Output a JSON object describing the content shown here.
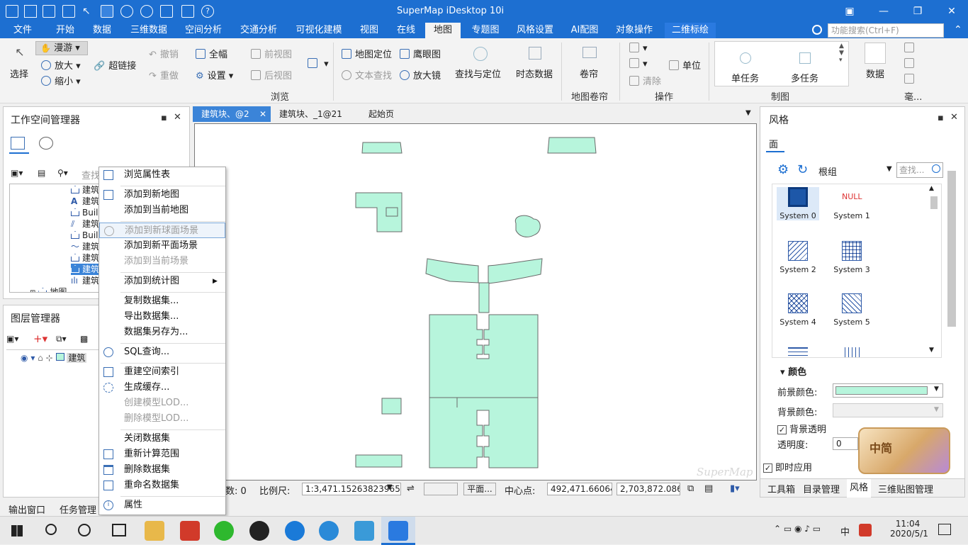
{
  "window": {
    "title": "SuperMap iDesktop 10i",
    "controls": [
      "restore",
      "minimize",
      "maximize",
      "close"
    ]
  },
  "quick_access": [
    "save-icon",
    "new-window-icon",
    "open-icon",
    "pointer-icon",
    "pan-icon",
    "zoom-in-icon",
    "zoom-out-icon",
    "fullextent-icon",
    "folder-icon",
    "help-icon"
  ],
  "menu_tabs": [
    "文件",
    "开始",
    "数据",
    "三维数据",
    "空间分析",
    "交通分析",
    "可视化建模",
    "视图",
    "在线",
    "地图",
    "专题图",
    "风格设置",
    "AI配图",
    "对象操作",
    "二维标绘"
  ],
  "active_tab": "地图",
  "search": {
    "placeholder": "功能搜索(Ctrl+F)"
  },
  "ribbon": {
    "select": "选择",
    "roam": "漫游",
    "zoom_in": "放大",
    "zoom_out": "缩小",
    "hyperlink": "超链接",
    "undo": "撤销",
    "redo": "重做",
    "full_extent": "全幅",
    "settings": "设置",
    "prev_view": "前视图",
    "next_view": "后视图",
    "map_locate": "地图定位",
    "eagle_eye": "鹰眼图",
    "text_search": "文本查找",
    "magnifier": "放大镜",
    "find_locate": "查找与定位",
    "dynamic_data": "时态数据",
    "curtain": "卷帘",
    "unit": "单位",
    "clear": "清除",
    "single_task": "单任务",
    "multi_task": "多任务",
    "data": "数据",
    "more": "毫...",
    "group_browse": "浏览",
    "group_curtain": "地图卷帘",
    "group_ops": "操作",
    "group_mapping": "制图"
  },
  "workspace": {
    "title": "工作空间管理器",
    "search_placeholder": "查找",
    "items": [
      "建筑",
      "建筑",
      "Build",
      "建筑",
      "Build",
      "建筑",
      "建筑",
      "建筑",
      "建筑",
      "地图"
    ],
    "selected_index": 7
  },
  "layers": {
    "title": "图层管理器",
    "layer_name": "建筑"
  },
  "context_menu": {
    "items": [
      {
        "label": "浏览属性表",
        "disabled": false,
        "icon": "table-icon"
      },
      {
        "label": "添加到新地图",
        "disabled": false,
        "icon": "map-add-icon"
      },
      {
        "label": "添加到当前地图",
        "disabled": false,
        "icon": ""
      },
      {
        "label": "添加到新球面场景",
        "disabled": true,
        "icon": "globe-icon"
      },
      {
        "label": "添加到新平面场景",
        "disabled": false,
        "icon": ""
      },
      {
        "label": "添加到当前场景",
        "disabled": true,
        "icon": ""
      },
      {
        "label": "添加到统计图",
        "disabled": false,
        "icon": ""
      },
      {
        "label": "复制数据集...",
        "disabled": false,
        "icon": ""
      },
      {
        "label": "导出数据集...",
        "disabled": false,
        "icon": ""
      },
      {
        "label": "数据集另存为...",
        "disabled": false,
        "icon": ""
      },
      {
        "label": "SQL查询...",
        "disabled": false,
        "icon": "search-icon"
      },
      {
        "label": "重建空间索引",
        "disabled": false,
        "icon": "index-icon"
      },
      {
        "label": "生成缓存...",
        "disabled": false,
        "icon": "cache-icon"
      },
      {
        "label": "创建模型LOD...",
        "disabled": true,
        "icon": ""
      },
      {
        "label": "删除模型LOD...",
        "disabled": true,
        "icon": ""
      },
      {
        "label": "关闭数据集",
        "disabled": false,
        "icon": ""
      },
      {
        "label": "重新计算范围",
        "disabled": false,
        "icon": "recalc-icon"
      },
      {
        "label": "删除数据集",
        "disabled": false,
        "icon": "trash-icon"
      },
      {
        "label": "重命名数据集",
        "disabled": false,
        "icon": "rename-icon"
      },
      {
        "label": "属性",
        "disabled": false,
        "icon": "info-icon"
      }
    ]
  },
  "map_tabs": [
    "建筑块、@2",
    "建筑块、_1@21",
    "起始页"
  ],
  "status": {
    "count_label": "数: 0",
    "scale_label": "比例尺:",
    "scale_value": "1:3,471.15263823965",
    "mode": "平面...",
    "center_label": "中心点:",
    "center_x": "492,471.660644",
    "center_y": "2,703,872.086..."
  },
  "watermark": "SuperMap",
  "style_panel": {
    "title": "风格",
    "tab": "面",
    "group": "根组",
    "search_placeholder": "查找...",
    "symbols": [
      "System 0",
      "System 1",
      "System 2",
      "System 3",
      "System 4",
      "System 5"
    ],
    "null_label": "NULL",
    "color_section": "颜色",
    "fg_label": "前景颜色:",
    "bg_label": "背景颜色:",
    "bg_transparent": "背景透明",
    "transparency_label": "透明度:",
    "transparency_value": "0",
    "apply_now": "即时应用",
    "fg_color": "#b7f5dc",
    "ime_badge": "中简"
  },
  "right_bottom_tabs": [
    "工具箱",
    "目录管理",
    "风格",
    "三维贴图管理"
  ],
  "bottom_tabs": [
    "输出窗口",
    "任务管理"
  ],
  "taskbar": {
    "time": "11:04",
    "date": "2020/5/1",
    "ime": "中"
  }
}
